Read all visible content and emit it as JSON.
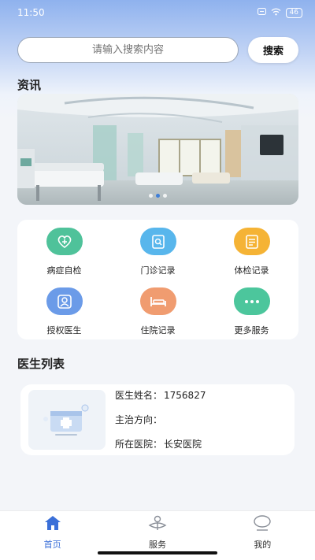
{
  "status_bar": {
    "time": "11:50",
    "battery": "46"
  },
  "search": {
    "placeholder": "请输入搜索内容",
    "button_label": "搜索"
  },
  "news": {
    "title": "资讯"
  },
  "services": [
    {
      "label": "病症自检",
      "icon": "health-check-icon",
      "color": "#4fc29a"
    },
    {
      "label": "门诊记录",
      "icon": "clinic-record-icon",
      "color": "#58b6ec"
    },
    {
      "label": "体检记录",
      "icon": "exam-record-icon",
      "color": "#f5b335"
    },
    {
      "label": "授权医生",
      "icon": "doctor-auth-icon",
      "color": "#6b9be8"
    },
    {
      "label": "住院记录",
      "icon": "hospital-bed-icon",
      "color": "#f09c70"
    },
    {
      "label": "更多服务",
      "icon": "more-icon",
      "color": "#4cc69c"
    }
  ],
  "doctor_list": {
    "title": "医生列表",
    "doctors": [
      {
        "name_label": "医生姓名：",
        "name": "1756827",
        "direction_label": "主治方向：",
        "direction": "",
        "hospital_label": "所在医院：",
        "hospital": "长安医院"
      }
    ]
  },
  "tabbar": {
    "items": [
      {
        "label": "首页",
        "icon": "home-icon",
        "active": true
      },
      {
        "label": "服务",
        "icon": "service-icon",
        "active": false
      },
      {
        "label": "我的",
        "icon": "profile-icon",
        "active": false
      }
    ],
    "active_color": "#3a6fd8"
  }
}
